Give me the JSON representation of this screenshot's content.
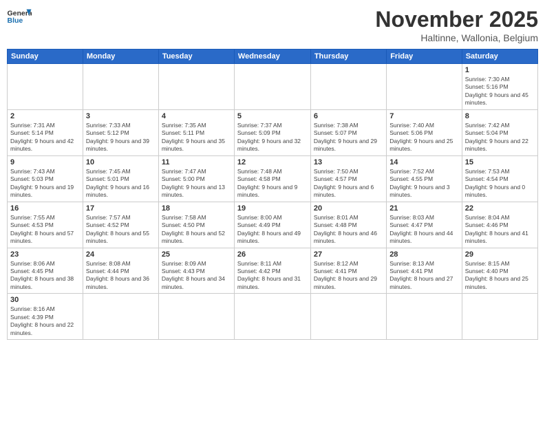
{
  "header": {
    "logo_general": "General",
    "logo_blue": "Blue",
    "title": "November 2025",
    "subtitle": "Haltinne, Wallonia, Belgium"
  },
  "days_of_week": [
    "Sunday",
    "Monday",
    "Tuesday",
    "Wednesday",
    "Thursday",
    "Friday",
    "Saturday"
  ],
  "weeks": [
    [
      null,
      null,
      null,
      null,
      null,
      null,
      {
        "day": "1",
        "sunrise": "Sunrise: 7:30 AM",
        "sunset": "Sunset: 5:16 PM",
        "daylight": "Daylight: 9 hours and 45 minutes."
      }
    ],
    [
      {
        "day": "2",
        "sunrise": "Sunrise: 7:31 AM",
        "sunset": "Sunset: 5:14 PM",
        "daylight": "Daylight: 9 hours and 42 minutes."
      },
      {
        "day": "3",
        "sunrise": "Sunrise: 7:33 AM",
        "sunset": "Sunset: 5:12 PM",
        "daylight": "Daylight: 9 hours and 39 minutes."
      },
      {
        "day": "4",
        "sunrise": "Sunrise: 7:35 AM",
        "sunset": "Sunset: 5:11 PM",
        "daylight": "Daylight: 9 hours and 35 minutes."
      },
      {
        "day": "5",
        "sunrise": "Sunrise: 7:37 AM",
        "sunset": "Sunset: 5:09 PM",
        "daylight": "Daylight: 9 hours and 32 minutes."
      },
      {
        "day": "6",
        "sunrise": "Sunrise: 7:38 AM",
        "sunset": "Sunset: 5:07 PM",
        "daylight": "Daylight: 9 hours and 29 minutes."
      },
      {
        "day": "7",
        "sunrise": "Sunrise: 7:40 AM",
        "sunset": "Sunset: 5:06 PM",
        "daylight": "Daylight: 9 hours and 25 minutes."
      },
      {
        "day": "8",
        "sunrise": "Sunrise: 7:42 AM",
        "sunset": "Sunset: 5:04 PM",
        "daylight": "Daylight: 9 hours and 22 minutes."
      }
    ],
    [
      {
        "day": "9",
        "sunrise": "Sunrise: 7:43 AM",
        "sunset": "Sunset: 5:03 PM",
        "daylight": "Daylight: 9 hours and 19 minutes."
      },
      {
        "day": "10",
        "sunrise": "Sunrise: 7:45 AM",
        "sunset": "Sunset: 5:01 PM",
        "daylight": "Daylight: 9 hours and 16 minutes."
      },
      {
        "day": "11",
        "sunrise": "Sunrise: 7:47 AM",
        "sunset": "Sunset: 5:00 PM",
        "daylight": "Daylight: 9 hours and 13 minutes."
      },
      {
        "day": "12",
        "sunrise": "Sunrise: 7:48 AM",
        "sunset": "Sunset: 4:58 PM",
        "daylight": "Daylight: 9 hours and 9 minutes."
      },
      {
        "day": "13",
        "sunrise": "Sunrise: 7:50 AM",
        "sunset": "Sunset: 4:57 PM",
        "daylight": "Daylight: 9 hours and 6 minutes."
      },
      {
        "day": "14",
        "sunrise": "Sunrise: 7:52 AM",
        "sunset": "Sunset: 4:55 PM",
        "daylight": "Daylight: 9 hours and 3 minutes."
      },
      {
        "day": "15",
        "sunrise": "Sunrise: 7:53 AM",
        "sunset": "Sunset: 4:54 PM",
        "daylight": "Daylight: 9 hours and 0 minutes."
      }
    ],
    [
      {
        "day": "16",
        "sunrise": "Sunrise: 7:55 AM",
        "sunset": "Sunset: 4:53 PM",
        "daylight": "Daylight: 8 hours and 57 minutes."
      },
      {
        "day": "17",
        "sunrise": "Sunrise: 7:57 AM",
        "sunset": "Sunset: 4:52 PM",
        "daylight": "Daylight: 8 hours and 55 minutes."
      },
      {
        "day": "18",
        "sunrise": "Sunrise: 7:58 AM",
        "sunset": "Sunset: 4:50 PM",
        "daylight": "Daylight: 8 hours and 52 minutes."
      },
      {
        "day": "19",
        "sunrise": "Sunrise: 8:00 AM",
        "sunset": "Sunset: 4:49 PM",
        "daylight": "Daylight: 8 hours and 49 minutes."
      },
      {
        "day": "20",
        "sunrise": "Sunrise: 8:01 AM",
        "sunset": "Sunset: 4:48 PM",
        "daylight": "Daylight: 8 hours and 46 minutes."
      },
      {
        "day": "21",
        "sunrise": "Sunrise: 8:03 AM",
        "sunset": "Sunset: 4:47 PM",
        "daylight": "Daylight: 8 hours and 44 minutes."
      },
      {
        "day": "22",
        "sunrise": "Sunrise: 8:04 AM",
        "sunset": "Sunset: 4:46 PM",
        "daylight": "Daylight: 8 hours and 41 minutes."
      }
    ],
    [
      {
        "day": "23",
        "sunrise": "Sunrise: 8:06 AM",
        "sunset": "Sunset: 4:45 PM",
        "daylight": "Daylight: 8 hours and 38 minutes."
      },
      {
        "day": "24",
        "sunrise": "Sunrise: 8:08 AM",
        "sunset": "Sunset: 4:44 PM",
        "daylight": "Daylight: 8 hours and 36 minutes."
      },
      {
        "day": "25",
        "sunrise": "Sunrise: 8:09 AM",
        "sunset": "Sunset: 4:43 PM",
        "daylight": "Daylight: 8 hours and 34 minutes."
      },
      {
        "day": "26",
        "sunrise": "Sunrise: 8:11 AM",
        "sunset": "Sunset: 4:42 PM",
        "daylight": "Daylight: 8 hours and 31 minutes."
      },
      {
        "day": "27",
        "sunrise": "Sunrise: 8:12 AM",
        "sunset": "Sunset: 4:41 PM",
        "daylight": "Daylight: 8 hours and 29 minutes."
      },
      {
        "day": "28",
        "sunrise": "Sunrise: 8:13 AM",
        "sunset": "Sunset: 4:41 PM",
        "daylight": "Daylight: 8 hours and 27 minutes."
      },
      {
        "day": "29",
        "sunrise": "Sunrise: 8:15 AM",
        "sunset": "Sunset: 4:40 PM",
        "daylight": "Daylight: 8 hours and 25 minutes."
      }
    ],
    [
      {
        "day": "30",
        "sunrise": "Sunrise: 8:16 AM",
        "sunset": "Sunset: 4:39 PM",
        "daylight": "Daylight: 8 hours and 22 minutes."
      },
      null,
      null,
      null,
      null,
      null,
      null
    ]
  ]
}
